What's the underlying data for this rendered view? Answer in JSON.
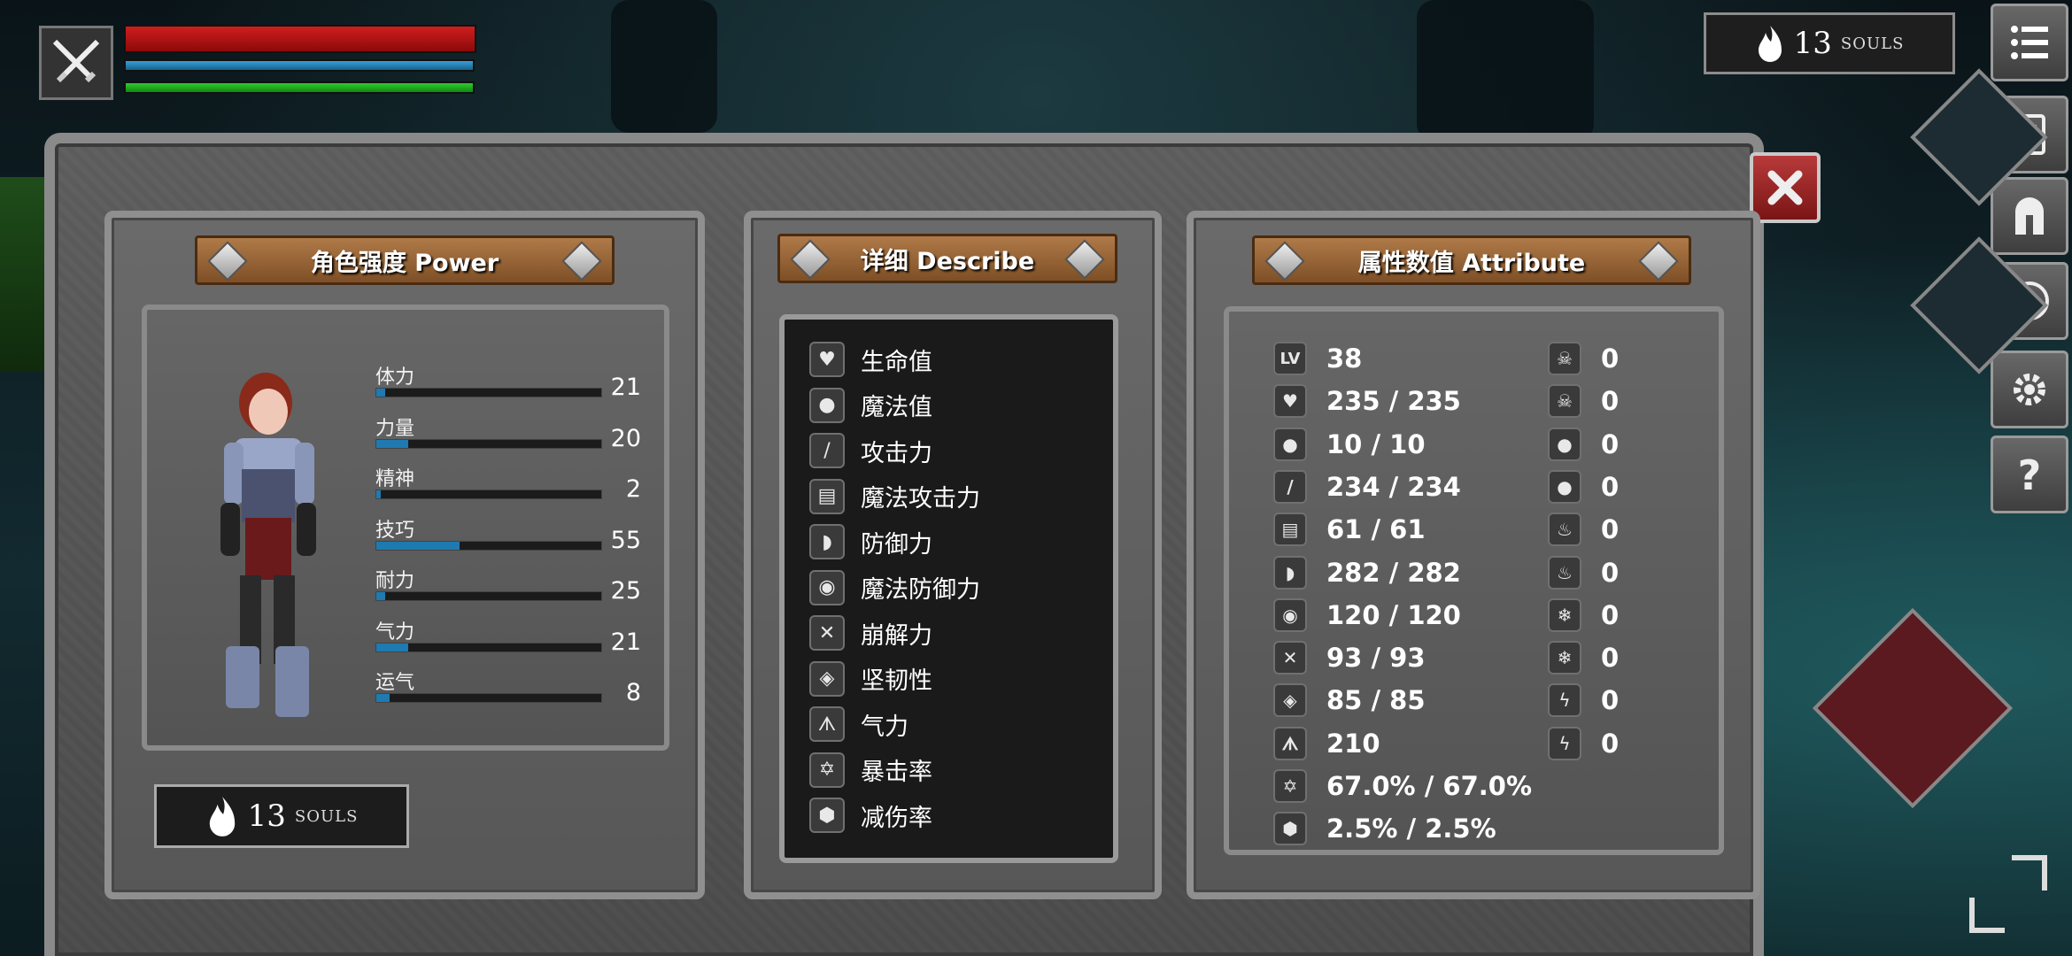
{
  "hud": {
    "health_pct": 100,
    "mana_pct": 100,
    "stamina_pct": 100,
    "souls_count": "13",
    "souls_label": "SOULS"
  },
  "menu": [
    "list-icon",
    "journal-icon",
    "helmet-icon",
    "rune-icon",
    "gear-icon",
    "help-icon"
  ],
  "panels": {
    "power_title": "角色强度 Power",
    "describe_title": "详细 Describe",
    "attribute_title": "属性数值 Attribute"
  },
  "power_stats": [
    {
      "label": "体力",
      "value": "21",
      "fill": 0.04
    },
    {
      "label": "力量",
      "value": "20",
      "fill": 0.14
    },
    {
      "label": "精神",
      "value": "2",
      "fill": 0.02
    },
    {
      "label": "技巧",
      "value": "55",
      "fill": 0.37
    },
    {
      "label": "耐力",
      "value": "25",
      "fill": 0.04
    },
    {
      "label": "气力",
      "value": "21",
      "fill": 0.14
    },
    {
      "label": "运气",
      "value": "8",
      "fill": 0.06
    }
  ],
  "souls_panel": {
    "count": "13",
    "label": "SOULS"
  },
  "describe": [
    {
      "icon": "heart-icon",
      "label": "生命值"
    },
    {
      "icon": "head-icon",
      "label": "魔法值"
    },
    {
      "icon": "sword-icon",
      "label": "攻击力"
    },
    {
      "icon": "spellbook-icon",
      "label": "魔法攻击力"
    },
    {
      "icon": "shield-icon",
      "label": "防御力"
    },
    {
      "icon": "magic-shield-icon",
      "label": "魔法防御力"
    },
    {
      "icon": "break-icon",
      "label": "崩解力"
    },
    {
      "icon": "helmet-icon",
      "label": "坚韧性"
    },
    {
      "icon": "lungs-icon",
      "label": "气力"
    },
    {
      "icon": "crit-star-icon",
      "label": "暴击率"
    },
    {
      "icon": "damage-reduction-icon",
      "label": "减伤率"
    }
  ],
  "attributes_left": [
    {
      "icon": "lv-icon",
      "text": "LV",
      "value": "38"
    },
    {
      "icon": "heart-icon",
      "value": "235 / 235"
    },
    {
      "icon": "head-icon",
      "value": "10 / 10"
    },
    {
      "icon": "sword-icon",
      "value": "234 / 234"
    },
    {
      "icon": "spellbook-icon",
      "value": "61 / 61"
    },
    {
      "icon": "shield-icon",
      "value": "282 / 282"
    },
    {
      "icon": "magic-shield-icon",
      "value": "120 / 120"
    },
    {
      "icon": "break-icon",
      "value": "93 / 93"
    },
    {
      "icon": "helmet-icon",
      "value": "85 / 85"
    },
    {
      "icon": "lungs-icon",
      "value": "210"
    },
    {
      "icon": "crit-star-icon",
      "value": "67.0% / 67.0%"
    },
    {
      "icon": "damage-reduction-icon",
      "value": "2.5% / 2.5%"
    }
  ],
  "attributes_right": [
    {
      "icon": "poison-skull-icon",
      "value": "0"
    },
    {
      "icon": "poison-resist-icon",
      "value": "0"
    },
    {
      "icon": "bleed-icon",
      "value": "0"
    },
    {
      "icon": "bleed-resist-icon",
      "value": "0"
    },
    {
      "icon": "fire-icon",
      "value": "0"
    },
    {
      "icon": "fire-resist-icon",
      "value": "0"
    },
    {
      "icon": "frost-icon",
      "value": "0"
    },
    {
      "icon": "frost-resist-icon",
      "value": "0"
    },
    {
      "icon": "lightning-icon",
      "value": "0"
    },
    {
      "icon": "lightning-resist-icon",
      "value": "0"
    }
  ],
  "colors": {
    "hp": "#d01e1e",
    "mp": "#3a9fd8",
    "stamina": "#2ecb2e",
    "stat_fill": "#1e7ab0",
    "close": "#a02424"
  }
}
